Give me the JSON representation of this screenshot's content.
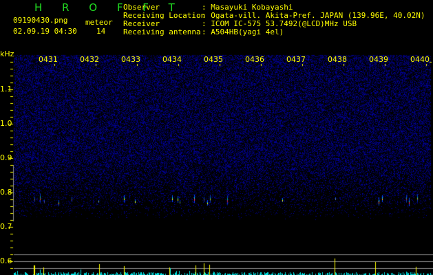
{
  "header": {
    "app_title": "H R O F F T",
    "filename": "09190430.png",
    "datetime": "02.09.19 04:30",
    "meteor_label": "meteor",
    "meteor_count": "14",
    "info": [
      {
        "label": "Observer",
        "value": ": Masayuki Kobayashi"
      },
      {
        "label": "Receiving Location",
        "value": ": Ogata-vill. Akita-Pref. JAPAN (139.96E, 40.02N)"
      },
      {
        "label": "Receiver",
        "value": ": ICOM IC-575 53.7492(@LCD)MHz USB"
      },
      {
        "label": "Receiving antenna",
        "value": ": A504HB(yagi 4el)"
      }
    ]
  },
  "axis": {
    "unit": "kHz",
    "y_ticks": [
      "1.1",
      "1.0",
      "0.9",
      "0.8",
      "0.7",
      "0.6"
    ],
    "x_ticks": [
      "0431",
      "0432",
      "0433",
      "0434",
      "0435",
      "0436",
      "0437",
      "0438",
      "0439",
      "0440"
    ]
  },
  "colors": {
    "text": "#ffff00",
    "title": "#22dd22",
    "noise": "#1a1aa0",
    "bars_low": "#00e0e0",
    "bars_high": "#ffff00",
    "grid": "#909090"
  }
}
